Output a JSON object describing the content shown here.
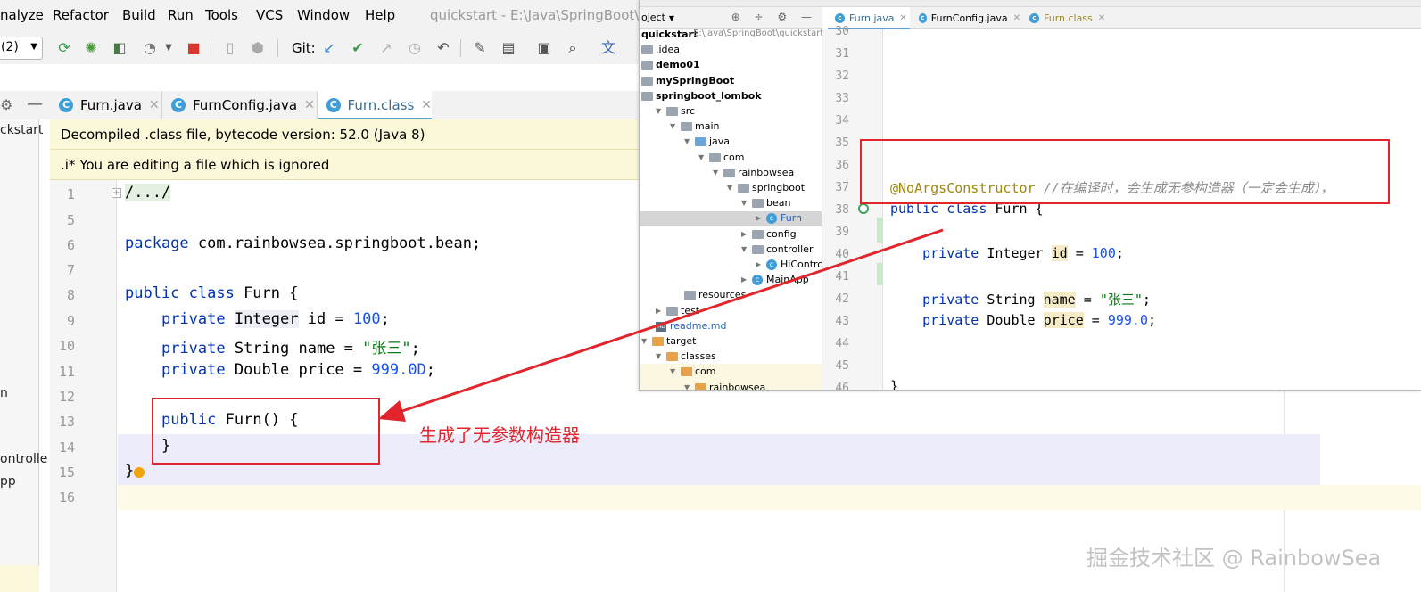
{
  "menubar": {
    "items": [
      "nalyze",
      "Refactor",
      "Build",
      "Run",
      "Tools",
      "VCS",
      "Window",
      "Help"
    ],
    "window_title": "quickstart - E:\\Java\\SpringBoot\\qu"
  },
  "toolbar": {
    "run_config": "(2)",
    "git_label": "Git:",
    "icons": [
      "rerun-icon",
      "debug-icon",
      "coverage-icon",
      "profile-icon",
      "stop-icon",
      "build-icon",
      "update-icon",
      "commit-icon",
      "push-icon",
      "history-icon",
      "rollback-icon",
      "settings-wrench-icon",
      "project-structure-icon",
      "terminal-icon",
      "search-icon",
      "translate-icon"
    ]
  },
  "left_panel": {
    "fragments": [
      "ckstart",
      "n",
      "ontrolle",
      "pp"
    ]
  },
  "editor": {
    "tabs": [
      {
        "label": "Furn.java",
        "icon": "C",
        "active": false
      },
      {
        "label": "FurnConfig.java",
        "icon": "C",
        "active": false
      },
      {
        "label": "Furn.class",
        "icon": "C",
        "active": true
      }
    ],
    "banner_decompiled": "Decompiled .class file, bytecode version: 52.0 (Java 8)",
    "banner_ignored": ".i* You are editing a file which is ignored",
    "line_numbers": [
      "1",
      "5",
      "6",
      "7",
      "8",
      "9",
      "10",
      "11",
      "12",
      "13",
      "14",
      "15",
      "16"
    ],
    "code": {
      "l1": "/.../",
      "l6_kw": "package",
      "l6_rest": " com.rainbowsea.springboot.bean;",
      "l8_kw": "public class",
      "l8_rest": " Furn {",
      "l9_kw": "private",
      "l9_type": "Integer",
      "l9_rest": " id = ",
      "l9_num": "100",
      "l9_end": ";",
      "l10_kw": "private",
      "l10_rest": " String name = ",
      "l10_str": "\"张三\"",
      "l10_end": ";",
      "l11_kw": "private",
      "l11_rest": " Double price = ",
      "l11_num": "999.0D",
      "l11_end": ";",
      "l13_kw": "public",
      "l13_rest": " Furn() {",
      "l14": "}",
      "l15": "}"
    },
    "annotation": "生成了无参数构造器"
  },
  "overlay": {
    "breadcrumb": "",
    "project_header": "oject",
    "tree": [
      {
        "label": "quickstart",
        "extra": "E:\\Java\\SpringBoot\\quickstart",
        "level": 0,
        "bold": true,
        "arrow": "",
        "icon": "none"
      },
      {
        "label": ".idea",
        "level": 0,
        "arrow": "",
        "icon": "folder-gray"
      },
      {
        "label": "demo01",
        "level": 0,
        "bold": true,
        "arrow": "",
        "icon": "folder-gray"
      },
      {
        "label": "mySpringBoot",
        "level": 0,
        "bold": true,
        "arrow": "",
        "icon": "folder-gray"
      },
      {
        "label": "springboot_lombok",
        "level": 0,
        "bold": true,
        "arrow": "",
        "icon": "folder-gray"
      },
      {
        "label": "src",
        "level": 1,
        "arrow": "▼",
        "icon": "folder-gray"
      },
      {
        "label": "main",
        "level": 2,
        "arrow": "▼",
        "icon": "folder-gray"
      },
      {
        "label": "java",
        "level": 3,
        "arrow": "▼",
        "icon": "folder-blue"
      },
      {
        "label": "com",
        "level": 4,
        "arrow": "▼",
        "icon": "folder-gray"
      },
      {
        "label": "rainbowsea",
        "level": 5,
        "arrow": "▼",
        "icon": "folder-gray"
      },
      {
        "label": "springboot",
        "level": 6,
        "arrow": "▼",
        "icon": "folder-gray"
      },
      {
        "label": "bean",
        "level": 7,
        "arrow": "▼",
        "icon": "folder-gray"
      },
      {
        "label": "Furn",
        "level": 8,
        "arrow": "▶",
        "icon": "class",
        "selected": true
      },
      {
        "label": "config",
        "level": 7,
        "arrow": "▶",
        "icon": "folder-gray"
      },
      {
        "label": "controller",
        "level": 7,
        "arrow": "▼",
        "icon": "folder-gray"
      },
      {
        "label": "HiControlle",
        "level": 8,
        "arrow": "▶",
        "icon": "class"
      },
      {
        "label": "MainApp",
        "level": 7,
        "arrow": "▶",
        "icon": "class"
      },
      {
        "label": "resources",
        "level": 3,
        "arrow": "",
        "icon": "folder-gray"
      },
      {
        "label": "test",
        "level": 1,
        "arrow": "▶",
        "icon": "folder-gray"
      },
      {
        "label": "readme.md",
        "level": 1,
        "arrow": "",
        "icon": "md"
      },
      {
        "label": "target",
        "level": 0,
        "arrow": "▼",
        "icon": "folder-orange"
      },
      {
        "label": "classes",
        "level": 1,
        "arrow": "▼",
        "icon": "folder-orange"
      },
      {
        "label": "com",
        "level": 2,
        "arrow": "▼",
        "icon": "folder-orange"
      },
      {
        "label": "rainbowsea",
        "level": 3,
        "arrow": "▼",
        "icon": "folder-orange"
      }
    ],
    "tabs": [
      {
        "label": "Furn.java",
        "active": true
      },
      {
        "label": "FurnConfig.java",
        "active": false
      },
      {
        "label": "Furn.class",
        "active": false
      }
    ],
    "line_numbers": [
      "30",
      "31",
      "32",
      "33",
      "34",
      "35",
      "36",
      "37",
      "38",
      "39",
      "40",
      "41",
      "42",
      "43",
      "44",
      "45",
      "46"
    ],
    "code": {
      "l37_ann": "@NoArgsConstructor",
      "l37_cmt": " //在编译时，会生成无参构造器（一定会生成），",
      "l38_kw": "public class",
      "l38_rest": " Furn {",
      "l40_kw": "private",
      "l40_rest": " Integer ",
      "l40_fld": "id",
      "l40_eq": " = ",
      "l40_num": "100",
      "l40_end": ";",
      "l42_kw": "private",
      "l42_rest": " String ",
      "l42_fld": "name",
      "l42_eq": " = ",
      "l42_str": "\"张三\"",
      "l42_end": ";",
      "l43_kw": "private",
      "l43_rest": " Double ",
      "l43_fld": "price",
      "l43_eq": " = ",
      "l43_num": "999.0",
      "l43_end": ";",
      "l46": "}"
    }
  },
  "watermark": "掘金技术社区 @ RainbowSea",
  "colors": {
    "annotation_red": "#e0262c",
    "keyword": "#0033b3",
    "string": "#067d17",
    "number": "#1750eb",
    "banner_bg": "#fbf7d9"
  }
}
